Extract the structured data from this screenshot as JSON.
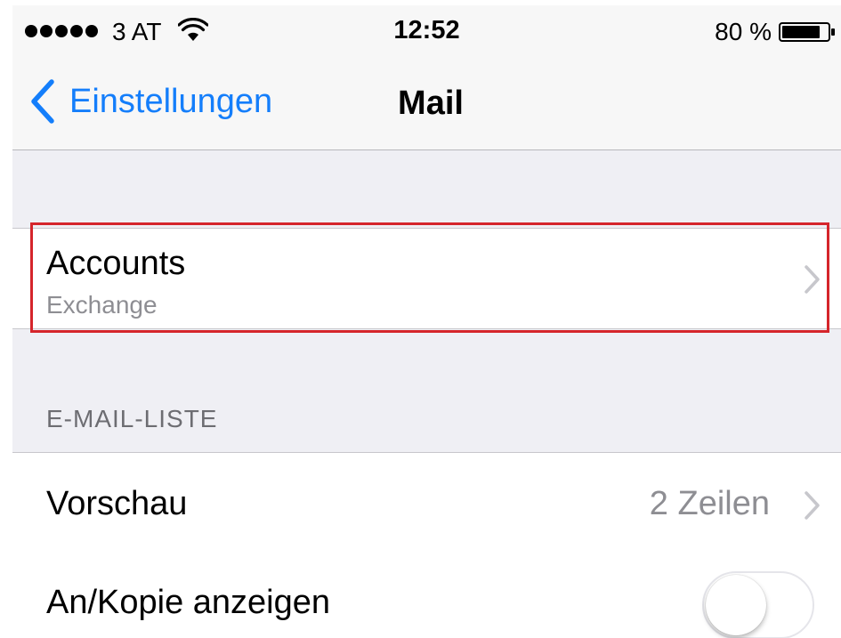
{
  "status_bar": {
    "carrier": "3 AT",
    "time": "12:52",
    "battery_percent": "80 %"
  },
  "nav": {
    "back_label": "Einstellungen",
    "title": "Mail"
  },
  "accounts": {
    "title": "Accounts",
    "subtitle": "Exchange"
  },
  "section_email_list": {
    "header": "E-MAIL-LISTE"
  },
  "preview": {
    "label": "Vorschau",
    "value": "2 Zeilen"
  },
  "show_to_cc": {
    "label": "An/Kopie anzeigen",
    "enabled": false
  },
  "colors": {
    "accent": "#147efb",
    "highlight": "#d5252b",
    "background": "#efeff4"
  }
}
